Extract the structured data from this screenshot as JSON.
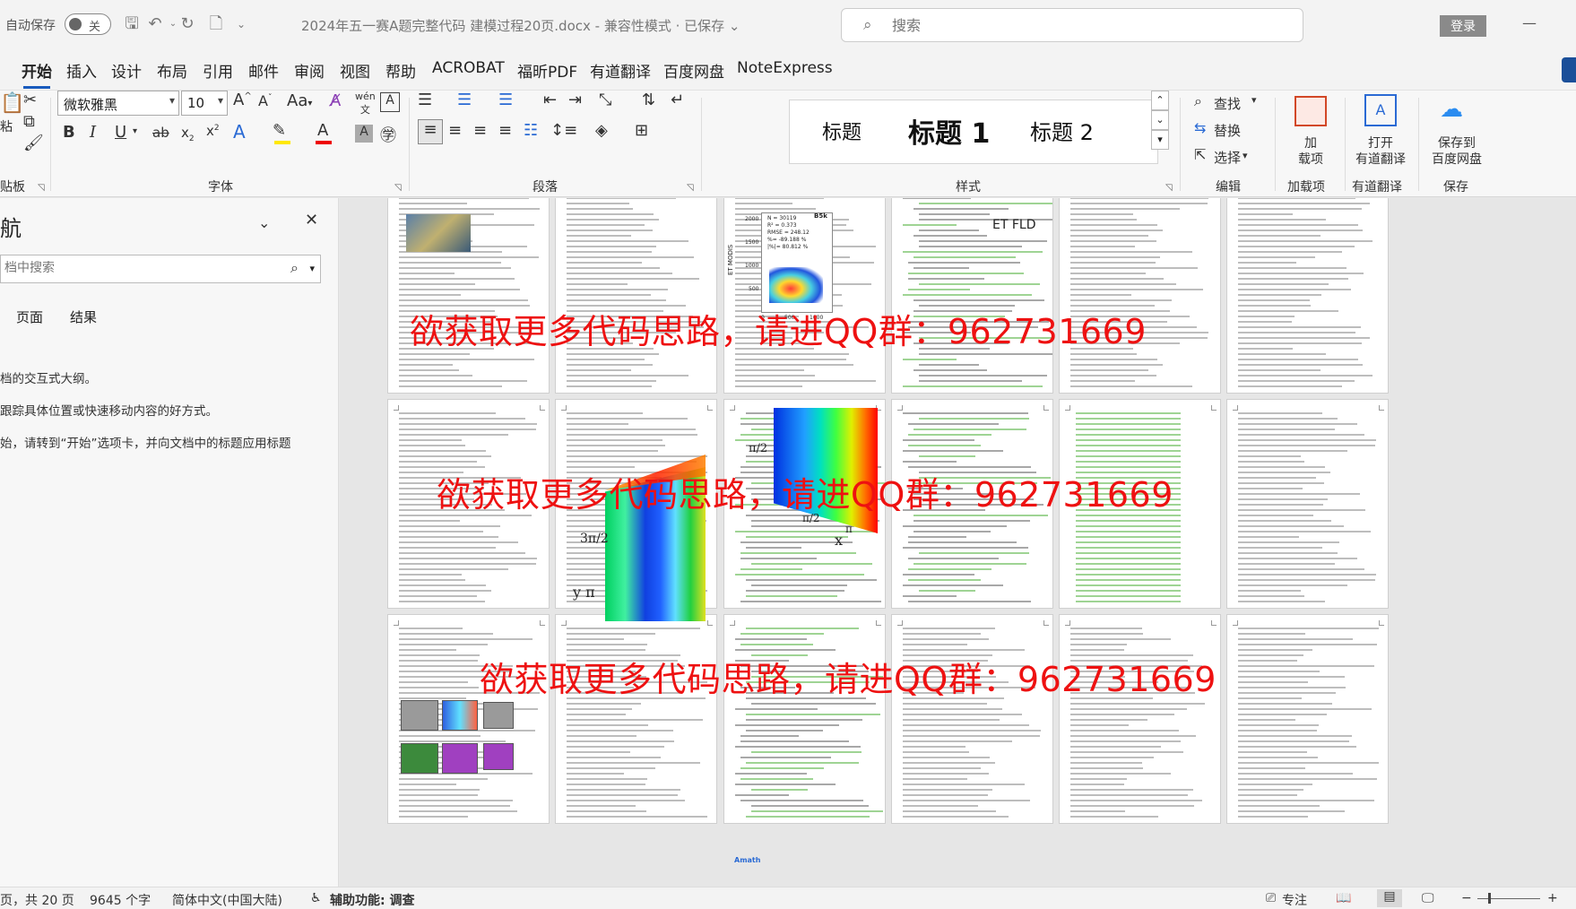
{
  "titlebar": {
    "autosave_label": "自动保存",
    "autosave_state": "关",
    "doc_title": "2024年五一赛A题完整代码 建模过程20页.docx - 兼容性模式 · 已保存 ⌄",
    "search_placeholder": "搜索",
    "login_label": "登录"
  },
  "menu": {
    "tabs": [
      "开始",
      "插入",
      "设计",
      "布局",
      "引用",
      "邮件",
      "审阅",
      "视图",
      "帮助",
      "ACROBAT",
      "福昕PDF",
      "有道翻译",
      "百度网盘",
      "NoteExpress"
    ],
    "active": "开始"
  },
  "ribbon": {
    "font_name": "微软雅黑",
    "font_size": "10",
    "styles": [
      "标题",
      "标题 1",
      "标题 2"
    ],
    "find_label": "查找",
    "replace_label": "替换",
    "select_label": "选择",
    "addins_label_1": "加",
    "addins_label_2": "载项",
    "youdao_label_1": "打开",
    "youdao_label_2": "有道翻译",
    "baidu_label_1": "保存到",
    "baidu_label_2": "百度网盘",
    "group_labels": {
      "clipboard": "贴板",
      "font": "字体",
      "paragraph": "段落",
      "styles": "样式",
      "editing": "编辑",
      "addins": "加载项",
      "youdao": "有道翻译",
      "save": "保存"
    },
    "clipboard_paste": "粘"
  },
  "nav": {
    "title": "航",
    "search_placeholder": "档中搜索",
    "tabs": [
      "页面",
      "结果"
    ],
    "lines": [
      "档的交互式大纲。",
      "跟踪具体位置或快速移动内容的好方式。",
      "始，请转到“开始”选项卡，并向文档中的标题应用标题"
    ]
  },
  "watermark_text": "欲获取更多代码思路，请进QQ群：962731669",
  "thumb_labels": {
    "fig_legend": [
      "N = 30119",
      "R² = 0.373",
      "RMSE = 248.12",
      "%= -89.188 %",
      "|%|= 80.812 %"
    ],
    "fig_title": "B5k",
    "fig_ylabel": "ET MODIS",
    "fig_yticks": [
      "2000",
      "1500",
      "1000",
      "500"
    ],
    "fig_xticks": [
      "0",
      "500",
      "1000"
    ],
    "page4_header": "ET FLD",
    "pi_half": "π/2",
    "three_pi_half": "3π/2",
    "y_pi": "y π",
    "x_label": "x",
    "pi_label": "π",
    "logo": "Amath"
  },
  "status": {
    "page": "页，共 20 页",
    "words": "9645 个字",
    "lang": "简体中文(中国大陆)",
    "accessibility": "辅助功能: 调查",
    "focus": "专注"
  }
}
